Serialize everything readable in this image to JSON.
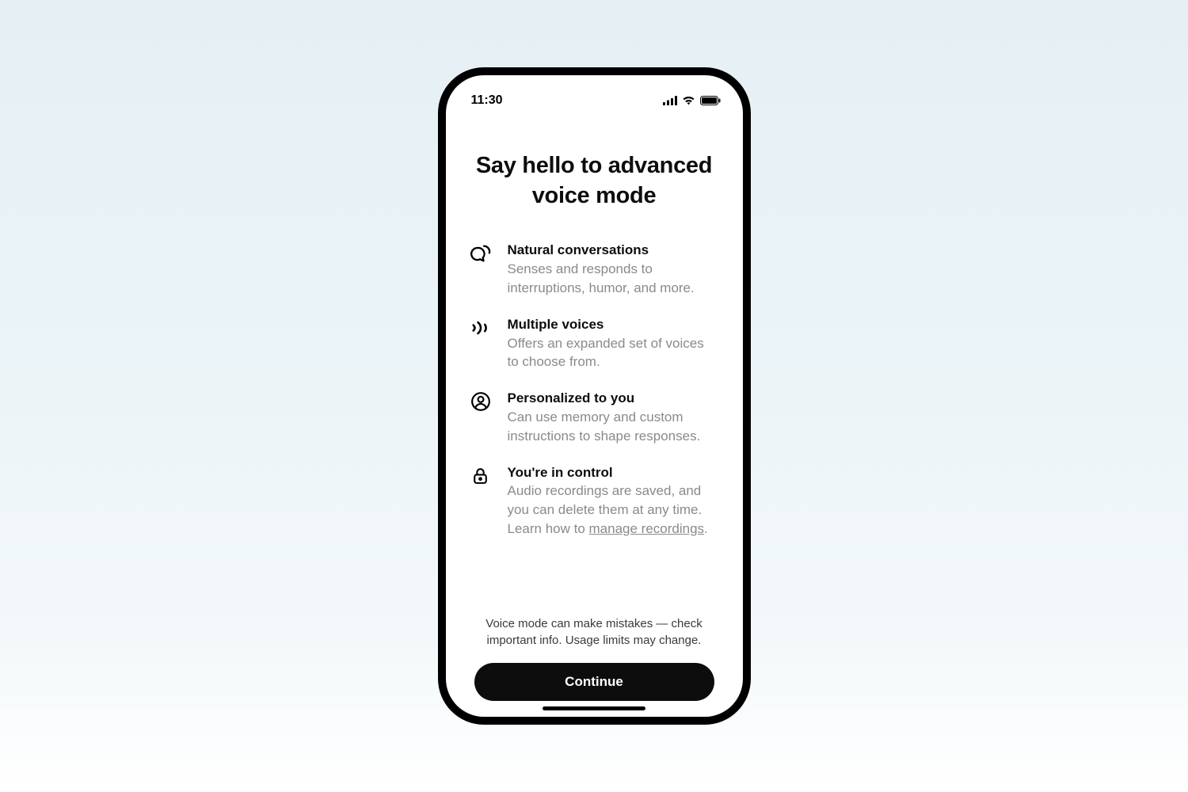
{
  "status": {
    "time": "11:30"
  },
  "title": "Say hello to advanced voice mode",
  "features": [
    {
      "title": "Natural conversations",
      "desc": "Senses and responds to interruptions, humor, and more."
    },
    {
      "title": "Multiple voices",
      "desc": "Offers an expanded set of voices to choose from."
    },
    {
      "title": "Personalized to you",
      "desc": "Can use memory and custom instructions to shape responses."
    },
    {
      "title": "You're in control",
      "desc_before": "Audio recordings are saved, and you can delete them at any time. Learn how to ",
      "link_text": "manage recordings",
      "desc_after": "."
    }
  ],
  "disclaimer": "Voice mode can make mistakes — check important info. Usage limits may change.",
  "continue_label": "Continue"
}
